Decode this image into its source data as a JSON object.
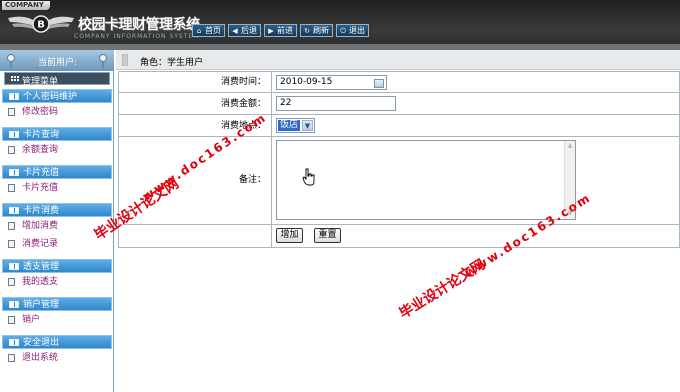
{
  "header": {
    "company_tag": "COMPANY",
    "title": "校园卡理财管理系统",
    "subtitle": "COMPANY INFORMATION SYSTEM",
    "nav": [
      {
        "label": "首页",
        "icon": "home-icon"
      },
      {
        "label": "后退",
        "icon": "back-arrow-icon"
      },
      {
        "label": "前进",
        "icon": "forward-arrow-icon"
      },
      {
        "label": "刷新",
        "icon": "refresh-icon"
      },
      {
        "label": "退出",
        "icon": "power-icon"
      }
    ]
  },
  "sidebar": {
    "current_user_label": "当前用户:",
    "menu_title": "管理菜单",
    "groups": [
      {
        "title": "个人密码维护",
        "items": [
          "修改密码"
        ]
      },
      {
        "title": "卡片查询",
        "items": [
          "余额查询"
        ]
      },
      {
        "title": "卡片充值",
        "items": [
          "卡片充值"
        ]
      },
      {
        "title": "卡片消费",
        "items": [
          "增加消费",
          "消费记录"
        ]
      },
      {
        "title": "透支管理",
        "items": [
          "我的透支"
        ]
      },
      {
        "title": "销户管理",
        "items": [
          "销户"
        ]
      },
      {
        "title": "安全退出",
        "items": [
          "退出系统"
        ]
      }
    ]
  },
  "content": {
    "role": "角色：学生用户",
    "form": {
      "time_label": "消费时间：",
      "time_value": "2010-09-15",
      "amount_label": "消费金额：",
      "amount_value": "22",
      "place_label": "消费地点：",
      "place_value": "饭店",
      "remark_label": "备注：",
      "remark_value": "",
      "submit_label": "增加",
      "reset_label": "重置"
    }
  },
  "watermarks": {
    "site": "www.doc163.com",
    "text": "毕业设计论文网"
  },
  "colors": {
    "header_bg": "#2a2a2a",
    "group_head": "#3b94d6",
    "menu_item_text": "#8a1c77",
    "watermark": "#e0000e"
  }
}
